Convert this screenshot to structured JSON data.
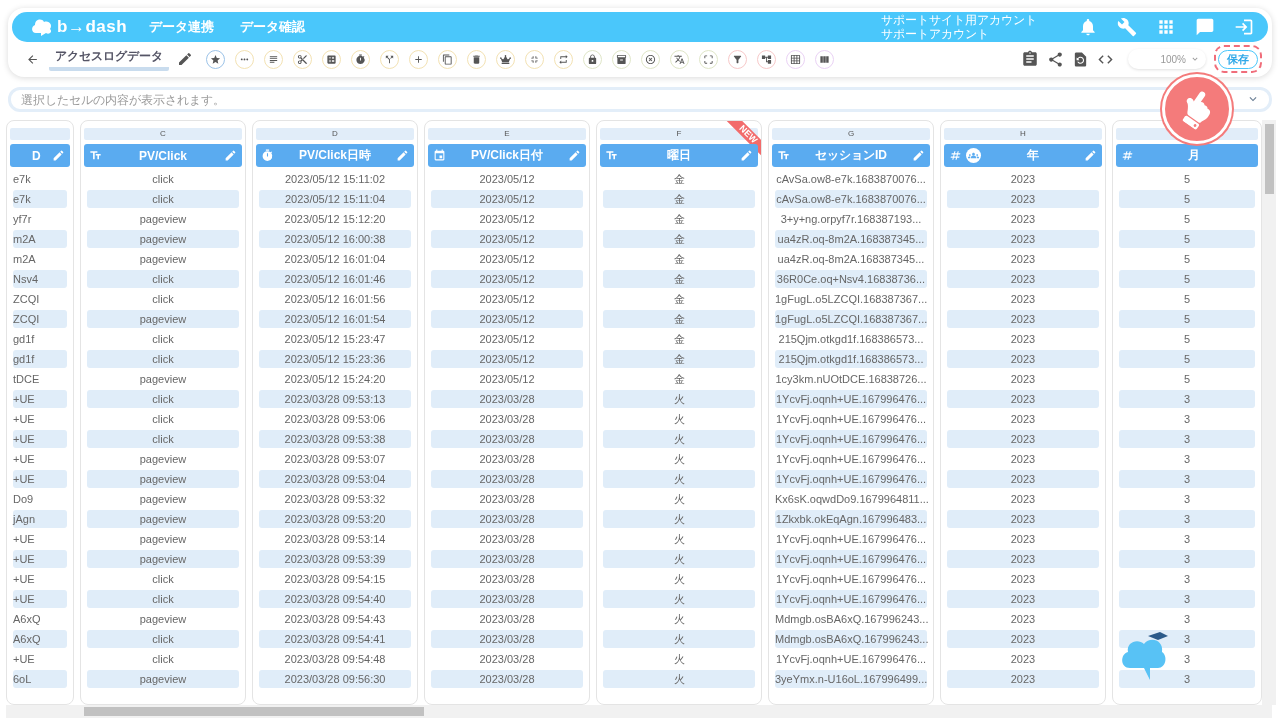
{
  "header": {
    "logo": "b→dash",
    "nav": [
      {
        "label": "データ連携"
      },
      {
        "label": "データ確認"
      }
    ],
    "account": [
      "サポートサイト用アカウント",
      "サポートアカウント"
    ]
  },
  "toolbar": {
    "sheet_title": "アクセスログデータ",
    "zoom": "100%",
    "save": "保存"
  },
  "formula_bar": {
    "placeholder": "選択したセルの内容が表示されます。"
  },
  "table": {
    "columns": [
      {
        "title": "D",
        "kind": "cut",
        "editable": true
      },
      {
        "letter": "C",
        "title": "PV/Click",
        "kind": "text",
        "editable": true
      },
      {
        "letter": "D",
        "title": "PV/Click日時",
        "kind": "datetime",
        "editable": true
      },
      {
        "letter": "E",
        "title": "PV/Click日付",
        "kind": "date",
        "editable": true
      },
      {
        "letter": "F",
        "title": "曜日",
        "kind": "text",
        "editable": true,
        "badge": "NEW"
      },
      {
        "letter": "G",
        "title": "セッションID",
        "kind": "text",
        "editable": true
      },
      {
        "letter": "H",
        "title": "年",
        "kind": "number",
        "editable": true,
        "grouped": true
      },
      {
        "title": "月",
        "kind": "number",
        "editable": false
      }
    ],
    "rows": [
      [
        "e7k",
        "click",
        "2023/05/12 15:11:02",
        "2023/05/12",
        "金",
        "cAvSa.ow8-e7k.1683870076...",
        "2023",
        "5"
      ],
      [
        "e7k",
        "click",
        "2023/05/12 15:11:04",
        "2023/05/12",
        "金",
        "cAvSa.ow8-e7k.1683870076...",
        "2023",
        "5"
      ],
      [
        "yf7r",
        "pageview",
        "2023/05/12 15:12:20",
        "2023/05/12",
        "金",
        "3+y+ng.orpyf7r.168387193...",
        "2023",
        "5"
      ],
      [
        "m2A",
        "pageview",
        "2023/05/12 16:00:38",
        "2023/05/12",
        "金",
        "ua4zR.oq-8m2A.168387345...",
        "2023",
        "5"
      ],
      [
        "m2A",
        "pageview",
        "2023/05/12 16:01:04",
        "2023/05/12",
        "金",
        "ua4zR.oq-8m2A.168387345...",
        "2023",
        "5"
      ],
      [
        "Nsv4",
        "click",
        "2023/05/12 16:01:46",
        "2023/05/12",
        "金",
        "36R0Ce.oq+Nsv4.16838736...",
        "2023",
        "5"
      ],
      [
        "ZCQI",
        "click",
        "2023/05/12 16:01:56",
        "2023/05/12",
        "金",
        "1gFugL.o5LZCQI.168387367...",
        "2023",
        "5"
      ],
      [
        "ZCQI",
        "pageview",
        "2023/05/12 16:01:54",
        "2023/05/12",
        "金",
        "1gFugL.o5LZCQI.168387367...",
        "2023",
        "5"
      ],
      [
        "gd1f",
        "click",
        "2023/05/12 15:23:47",
        "2023/05/12",
        "金",
        "215Qjm.otkgd1f.168386573...",
        "2023",
        "5"
      ],
      [
        "gd1f",
        "click",
        "2023/05/12 15:23:36",
        "2023/05/12",
        "金",
        "215Qjm.otkgd1f.168386573...",
        "2023",
        "5"
      ],
      [
        "tDCE",
        "pageview",
        "2023/05/12 15:24:20",
        "2023/05/12",
        "金",
        "1cy3km.nUOtDCE.16838726...",
        "2023",
        "5"
      ],
      [
        "+UE",
        "click",
        "2023/03/28 09:53:13",
        "2023/03/28",
        "火",
        "1YcvFj.oqnh+UE.167996476...",
        "2023",
        "3"
      ],
      [
        "+UE",
        "click",
        "2023/03/28 09:53:06",
        "2023/03/28",
        "火",
        "1YcvFj.oqnh+UE.167996476...",
        "2023",
        "3"
      ],
      [
        "+UE",
        "click",
        "2023/03/28 09:53:38",
        "2023/03/28",
        "火",
        "1YcvFj.oqnh+UE.167996476...",
        "2023",
        "3"
      ],
      [
        "+UE",
        "pageview",
        "2023/03/28 09:53:07",
        "2023/03/28",
        "火",
        "1YcvFj.oqnh+UE.167996476...",
        "2023",
        "3"
      ],
      [
        "+UE",
        "pageview",
        "2023/03/28 09:53:04",
        "2023/03/28",
        "火",
        "1YcvFj.oqnh+UE.167996476...",
        "2023",
        "3"
      ],
      [
        "Do9",
        "pageview",
        "2023/03/28 09:53:32",
        "2023/03/28",
        "火",
        "Kx6sK.oqwdDo9.1679964811...",
        "2023",
        "3"
      ],
      [
        "jAgn",
        "pageview",
        "2023/03/28 09:53:20",
        "2023/03/28",
        "火",
        "1Zkxbk.okEqAgn.167996483...",
        "2023",
        "3"
      ],
      [
        "+UE",
        "pageview",
        "2023/03/28 09:53:14",
        "2023/03/28",
        "火",
        "1YcvFj.oqnh+UE.167996476...",
        "2023",
        "3"
      ],
      [
        "+UE",
        "pageview",
        "2023/03/28 09:53:39",
        "2023/03/28",
        "火",
        "1YcvFj.oqnh+UE.167996476...",
        "2023",
        "3"
      ],
      [
        "+UE",
        "click",
        "2023/03/28 09:54:15",
        "2023/03/28",
        "火",
        "1YcvFj.oqnh+UE.167996476...",
        "2023",
        "3"
      ],
      [
        "+UE",
        "click",
        "2023/03/28 09:54:40",
        "2023/03/28",
        "火",
        "1YcvFj.oqnh+UE.167996476...",
        "2023",
        "3"
      ],
      [
        "A6xQ",
        "pageview",
        "2023/03/28 09:54:43",
        "2023/03/28",
        "火",
        "Mdmgb.osBA6xQ.167996243...",
        "2023",
        "3"
      ],
      [
        "A6xQ",
        "click",
        "2023/03/28 09:54:41",
        "2023/03/28",
        "火",
        "Mdmgb.osBA6xQ.167996243...",
        "2023",
        "3"
      ],
      [
        "+UE",
        "click",
        "2023/03/28 09:54:48",
        "2023/03/28",
        "火",
        "1YcvFj.oqnh+UE.167996476...",
        "2023",
        "3"
      ],
      [
        "6oL",
        "pageview",
        "2023/03/28 09:56:30",
        "2023/03/28",
        "火",
        "3yeYmx.n-U16oL.167996499...",
        "2023",
        "3"
      ]
    ]
  }
}
